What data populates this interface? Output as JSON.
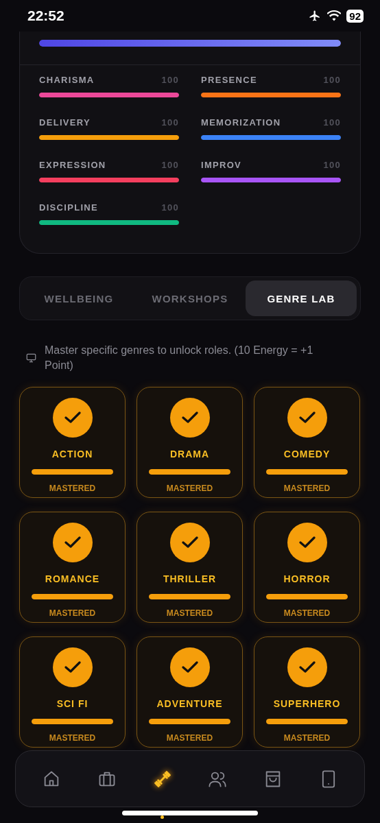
{
  "status_bar": {
    "time": "22:52",
    "battery": "92"
  },
  "overall": {
    "level": 1
  },
  "stats": [
    {
      "name": "CHARISMA",
      "value": "100",
      "level": 1,
      "color": "#ec4899"
    },
    {
      "name": "PRESENCE",
      "value": "100",
      "level": 1,
      "color": "#f97316"
    },
    {
      "name": "DELIVERY",
      "value": "100",
      "level": 1,
      "color": "#f59e0b"
    },
    {
      "name": "MEMORIZATION",
      "value": "100",
      "level": 1,
      "color": "#3b82f6"
    },
    {
      "name": "EXPRESSION",
      "value": "100",
      "level": 1,
      "color": "#f43f5e"
    },
    {
      "name": "IMPROV",
      "value": "100",
      "level": 1,
      "color": "#a855f7"
    },
    {
      "name": "DISCIPLINE",
      "value": "100",
      "level": 1,
      "color": "#10b981"
    }
  ],
  "tabs": [
    {
      "label": "WELLBEING",
      "selected": false
    },
    {
      "label": "WORKSHOPS",
      "selected": false
    },
    {
      "label": "GENRE LAB",
      "selected": true
    }
  ],
  "info": "Master specific genres to unlock roles. (10 Energy = +1 Point)",
  "genres": [
    {
      "name": "ACTION",
      "status": "MASTERED",
      "mastered": true,
      "level": 1
    },
    {
      "name": "DRAMA",
      "status": "MASTERED",
      "mastered": true,
      "level": 1
    },
    {
      "name": "COMEDY",
      "status": "MASTERED",
      "mastered": true,
      "level": 1
    },
    {
      "name": "ROMANCE",
      "status": "MASTERED",
      "mastered": true,
      "level": 1
    },
    {
      "name": "THRILLER",
      "status": "MASTERED",
      "mastered": true,
      "level": 1
    },
    {
      "name": "HORROR",
      "status": "MASTERED",
      "mastered": true,
      "level": 1
    },
    {
      "name": "SCI FI",
      "status": "MASTERED",
      "mastered": true,
      "level": 1
    },
    {
      "name": "ADVENTURE",
      "status": "MASTERED",
      "mastered": true,
      "level": 1
    },
    {
      "name": "SUPERHERO",
      "status": "MASTERED",
      "mastered": true,
      "level": 1
    }
  ],
  "nav": [
    {
      "kind": "home",
      "selected": false
    },
    {
      "kind": "briefcase",
      "selected": false
    },
    {
      "kind": "dumbbell",
      "selected": true
    },
    {
      "kind": "people",
      "selected": false
    },
    {
      "kind": "bag",
      "selected": false
    },
    {
      "kind": "tablet",
      "selected": false
    }
  ]
}
